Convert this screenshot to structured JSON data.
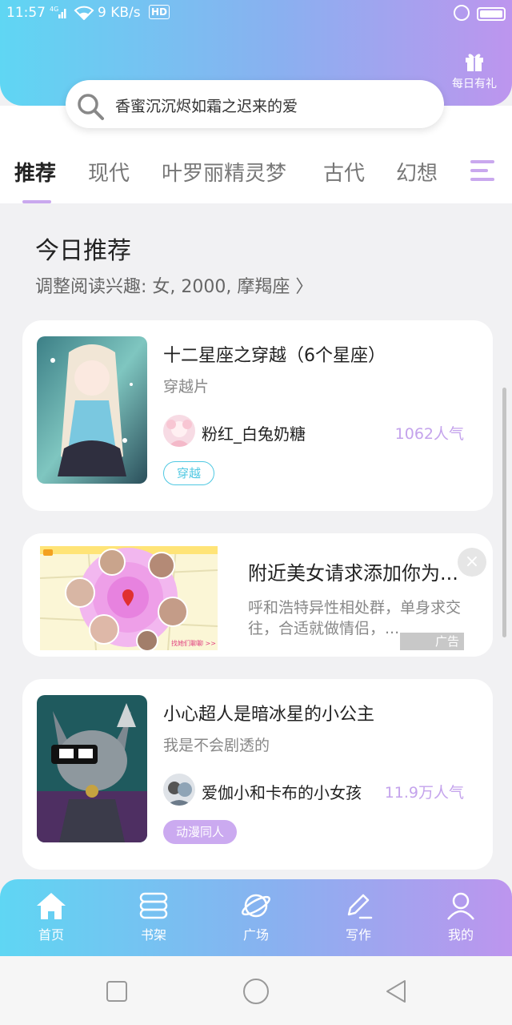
{
  "status_bar": {
    "time": "11:57",
    "signal": "4G",
    "speed": "9 KB/s",
    "hd": "HD"
  },
  "header": {
    "gift_label": "每日有礼",
    "search_placeholder": "香蜜沉沉烬如霜之迟来的爱"
  },
  "tabs": [
    {
      "label": "推荐",
      "active": true
    },
    {
      "label": "现代"
    },
    {
      "label": "叶罗丽精灵梦"
    },
    {
      "label": "古代"
    },
    {
      "label": "幻想"
    }
  ],
  "section": {
    "title": "今日推荐",
    "subtitle": "调整阅读兴趣: 女, 2000, 摩羯座 〉"
  },
  "books": [
    {
      "title": "十二星座之穿越（6个星座）",
      "desc": "穿越片",
      "author": "粉红_白兔奶糖",
      "popularity": "1062人气",
      "tag": "穿越"
    },
    {
      "title": "小心超人是暗冰星的小公主",
      "desc": "我是不会剧透的",
      "author": "爱伽小和卡布的小女孩",
      "popularity": "11.9万人气",
      "tag": "动漫同人"
    }
  ],
  "ad": {
    "title": "附近美女请求添加你为...",
    "desc": "呼和浩特异性相处群，单身求交往，合适就做情侣，...",
    "badge": "广告",
    "close": "×",
    "map_caption": "找她们聊聊 >>"
  },
  "bottom_nav": [
    {
      "label": "首页"
    },
    {
      "label": "书架"
    },
    {
      "label": "广场"
    },
    {
      "label": "写作"
    },
    {
      "label": "我的"
    }
  ],
  "colors": {
    "gradient_start": "#5fd6f3",
    "gradient_end": "#bd95ee",
    "accent_purple": "#c4a3ec",
    "accent_cyan": "#4fc8e2"
  }
}
